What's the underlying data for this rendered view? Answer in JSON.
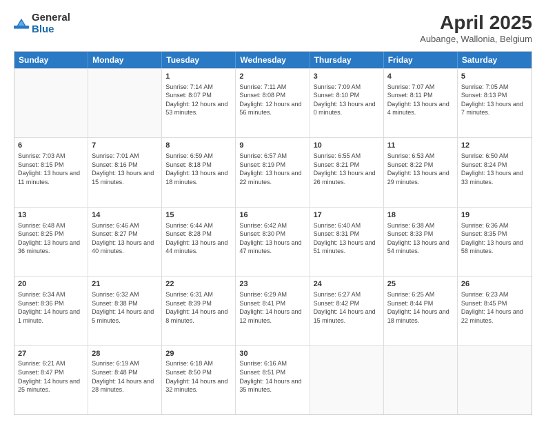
{
  "logo": {
    "general": "General",
    "blue": "Blue"
  },
  "title": "April 2025",
  "subtitle": "Aubange, Wallonia, Belgium",
  "weekdays": [
    "Sunday",
    "Monday",
    "Tuesday",
    "Wednesday",
    "Thursday",
    "Friday",
    "Saturday"
  ],
  "rows": [
    [
      {
        "day": "",
        "info": ""
      },
      {
        "day": "",
        "info": ""
      },
      {
        "day": "1",
        "info": "Sunrise: 7:14 AM\nSunset: 8:07 PM\nDaylight: 12 hours and 53 minutes."
      },
      {
        "day": "2",
        "info": "Sunrise: 7:11 AM\nSunset: 8:08 PM\nDaylight: 12 hours and 56 minutes."
      },
      {
        "day": "3",
        "info": "Sunrise: 7:09 AM\nSunset: 8:10 PM\nDaylight: 13 hours and 0 minutes."
      },
      {
        "day": "4",
        "info": "Sunrise: 7:07 AM\nSunset: 8:11 PM\nDaylight: 13 hours and 4 minutes."
      },
      {
        "day": "5",
        "info": "Sunrise: 7:05 AM\nSunset: 8:13 PM\nDaylight: 13 hours and 7 minutes."
      }
    ],
    [
      {
        "day": "6",
        "info": "Sunrise: 7:03 AM\nSunset: 8:15 PM\nDaylight: 13 hours and 11 minutes."
      },
      {
        "day": "7",
        "info": "Sunrise: 7:01 AM\nSunset: 8:16 PM\nDaylight: 13 hours and 15 minutes."
      },
      {
        "day": "8",
        "info": "Sunrise: 6:59 AM\nSunset: 8:18 PM\nDaylight: 13 hours and 18 minutes."
      },
      {
        "day": "9",
        "info": "Sunrise: 6:57 AM\nSunset: 8:19 PM\nDaylight: 13 hours and 22 minutes."
      },
      {
        "day": "10",
        "info": "Sunrise: 6:55 AM\nSunset: 8:21 PM\nDaylight: 13 hours and 26 minutes."
      },
      {
        "day": "11",
        "info": "Sunrise: 6:53 AM\nSunset: 8:22 PM\nDaylight: 13 hours and 29 minutes."
      },
      {
        "day": "12",
        "info": "Sunrise: 6:50 AM\nSunset: 8:24 PM\nDaylight: 13 hours and 33 minutes."
      }
    ],
    [
      {
        "day": "13",
        "info": "Sunrise: 6:48 AM\nSunset: 8:25 PM\nDaylight: 13 hours and 36 minutes."
      },
      {
        "day": "14",
        "info": "Sunrise: 6:46 AM\nSunset: 8:27 PM\nDaylight: 13 hours and 40 minutes."
      },
      {
        "day": "15",
        "info": "Sunrise: 6:44 AM\nSunset: 8:28 PM\nDaylight: 13 hours and 44 minutes."
      },
      {
        "day": "16",
        "info": "Sunrise: 6:42 AM\nSunset: 8:30 PM\nDaylight: 13 hours and 47 minutes."
      },
      {
        "day": "17",
        "info": "Sunrise: 6:40 AM\nSunset: 8:31 PM\nDaylight: 13 hours and 51 minutes."
      },
      {
        "day": "18",
        "info": "Sunrise: 6:38 AM\nSunset: 8:33 PM\nDaylight: 13 hours and 54 minutes."
      },
      {
        "day": "19",
        "info": "Sunrise: 6:36 AM\nSunset: 8:35 PM\nDaylight: 13 hours and 58 minutes."
      }
    ],
    [
      {
        "day": "20",
        "info": "Sunrise: 6:34 AM\nSunset: 8:36 PM\nDaylight: 14 hours and 1 minute."
      },
      {
        "day": "21",
        "info": "Sunrise: 6:32 AM\nSunset: 8:38 PM\nDaylight: 14 hours and 5 minutes."
      },
      {
        "day": "22",
        "info": "Sunrise: 6:31 AM\nSunset: 8:39 PM\nDaylight: 14 hours and 8 minutes."
      },
      {
        "day": "23",
        "info": "Sunrise: 6:29 AM\nSunset: 8:41 PM\nDaylight: 14 hours and 12 minutes."
      },
      {
        "day": "24",
        "info": "Sunrise: 6:27 AM\nSunset: 8:42 PM\nDaylight: 14 hours and 15 minutes."
      },
      {
        "day": "25",
        "info": "Sunrise: 6:25 AM\nSunset: 8:44 PM\nDaylight: 14 hours and 18 minutes."
      },
      {
        "day": "26",
        "info": "Sunrise: 6:23 AM\nSunset: 8:45 PM\nDaylight: 14 hours and 22 minutes."
      }
    ],
    [
      {
        "day": "27",
        "info": "Sunrise: 6:21 AM\nSunset: 8:47 PM\nDaylight: 14 hours and 25 minutes."
      },
      {
        "day": "28",
        "info": "Sunrise: 6:19 AM\nSunset: 8:48 PM\nDaylight: 14 hours and 28 minutes."
      },
      {
        "day": "29",
        "info": "Sunrise: 6:18 AM\nSunset: 8:50 PM\nDaylight: 14 hours and 32 minutes."
      },
      {
        "day": "30",
        "info": "Sunrise: 6:16 AM\nSunset: 8:51 PM\nDaylight: 14 hours and 35 minutes."
      },
      {
        "day": "",
        "info": ""
      },
      {
        "day": "",
        "info": ""
      },
      {
        "day": "",
        "info": ""
      }
    ]
  ]
}
